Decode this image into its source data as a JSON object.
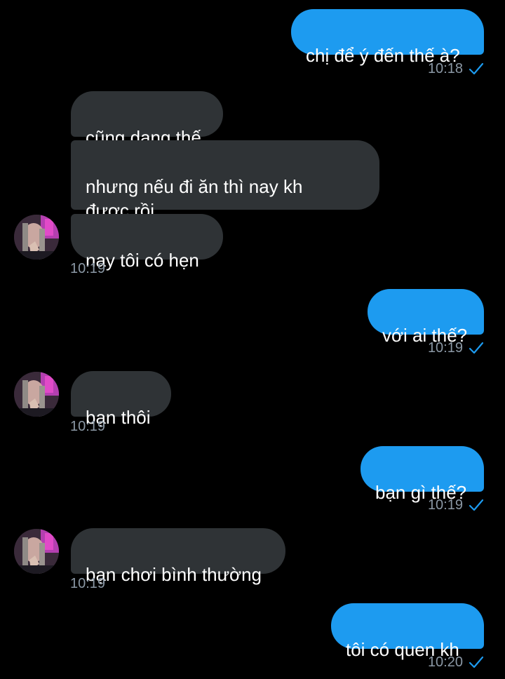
{
  "messages": [
    {
      "text": "chị để ý đến thế à?",
      "time": "10:18"
    },
    {
      "text": "cũng dạng thế"
    },
    {
      "text": "nhưng nếu đi ăn thì nay kh\nđược rồi"
    },
    {
      "text": "nay tôi có hẹn",
      "time": "10:19"
    },
    {
      "text": "với ai thế?",
      "time": "10:19"
    },
    {
      "text": "bạn thôi",
      "time": "10:19"
    },
    {
      "text": "bạn gì thế?",
      "time": "10:19"
    },
    {
      "text": "bạn chơi bình thường",
      "time": "10:19"
    },
    {
      "text": "tôi có quen kh",
      "time": "10:20"
    }
  ],
  "colors": {
    "background": "#000000",
    "outgoing_bubble": "#1d9bf0",
    "incoming_bubble": "#2f3336",
    "timestamp": "#8b98a5",
    "read_check": "#1d9bf0"
  },
  "icons": {
    "read_receipt": "checkmark-icon",
    "contact_avatar": "avatar"
  }
}
